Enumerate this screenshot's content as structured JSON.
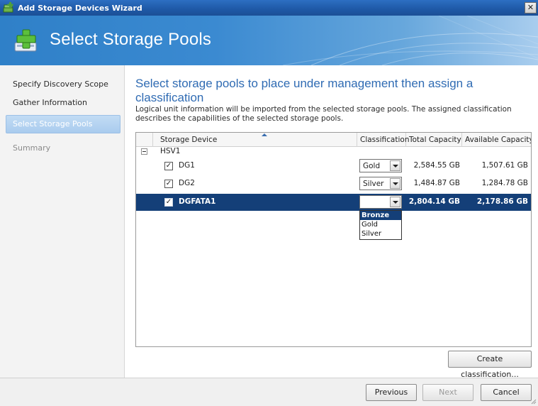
{
  "window": {
    "title": "Add Storage Devices Wizard",
    "close_glyph": "✕"
  },
  "banner": {
    "title": "Select Storage Pools",
    "icon": "add-storage-icon"
  },
  "nav": {
    "items": [
      {
        "label": "Specify Discovery Scope",
        "state": "normal"
      },
      {
        "label": "Gather Information",
        "state": "normal"
      },
      {
        "label": "Select Storage Pools",
        "state": "active"
      },
      {
        "label": "Summary",
        "state": "disabled"
      }
    ]
  },
  "main": {
    "heading": "Select storage pools to place under management then assign a classification",
    "description": "Logical unit information will be imported from the selected storage pools. The assigned classification describes the capabilities of the selected storage pools."
  },
  "grid": {
    "columns": [
      "Storage Device",
      "Classification",
      "Total Capacity",
      "Available Capacity"
    ],
    "group": "HSV1",
    "rows": [
      {
        "checked": true,
        "name": "DG1",
        "classification": "Gold",
        "total": "2,584.55 GB",
        "available": "1,507.61 GB",
        "selected": false
      },
      {
        "checked": true,
        "name": "DG2",
        "classification": "Silver",
        "total": "1,484.87 GB",
        "available": "1,284.78 GB",
        "selected": false
      },
      {
        "checked": true,
        "name": "DGFATA1",
        "classification": "",
        "total": "2,804.14 GB",
        "available": "2,178.86 GB",
        "selected": true
      }
    ],
    "dropdown_options": [
      "Bronze",
      "Gold",
      "Silver"
    ],
    "dropdown_highlighted": "Bronze"
  },
  "buttons": {
    "create_classification": "Create classification...",
    "previous": "Previous",
    "next": "Next",
    "cancel": "Cancel"
  },
  "colors": {
    "selection": "#143f78",
    "heading": "#2f6bb3",
    "titlebar": "#1f5aa8"
  }
}
